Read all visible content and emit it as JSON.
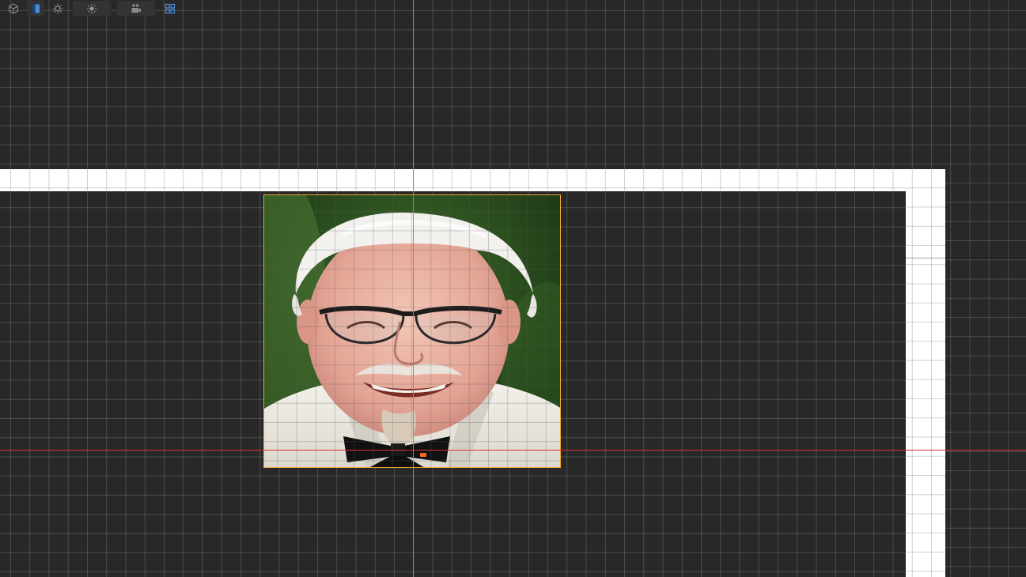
{
  "toolbar": {
    "buttons": [
      {
        "icon": "cube-icon",
        "role": "3d-view-toggle"
      },
      {
        "icon": "split-view-icon",
        "role": "view-mode",
        "active": true,
        "accent": "#4a8ad6"
      },
      {
        "icon": "light-icon",
        "role": "lighting"
      },
      {
        "icon": "sun-icon",
        "role": "exposure"
      },
      {
        "icon": "camera-icon",
        "role": "camera"
      },
      {
        "icon": "grid-icon",
        "role": "layout",
        "accent": "#4a8ad6"
      }
    ]
  },
  "canvas": {
    "background": "#282828",
    "frame_color": "#ffffff",
    "guides": {
      "vertical_color": "#1fcf3a",
      "horizontal_color": "#d8322c"
    },
    "selection_color": "#f2a431",
    "anchor_color": "#ff6a1a"
  },
  "photo_layer": {
    "subject": "portrait-photo",
    "selected": true
  }
}
